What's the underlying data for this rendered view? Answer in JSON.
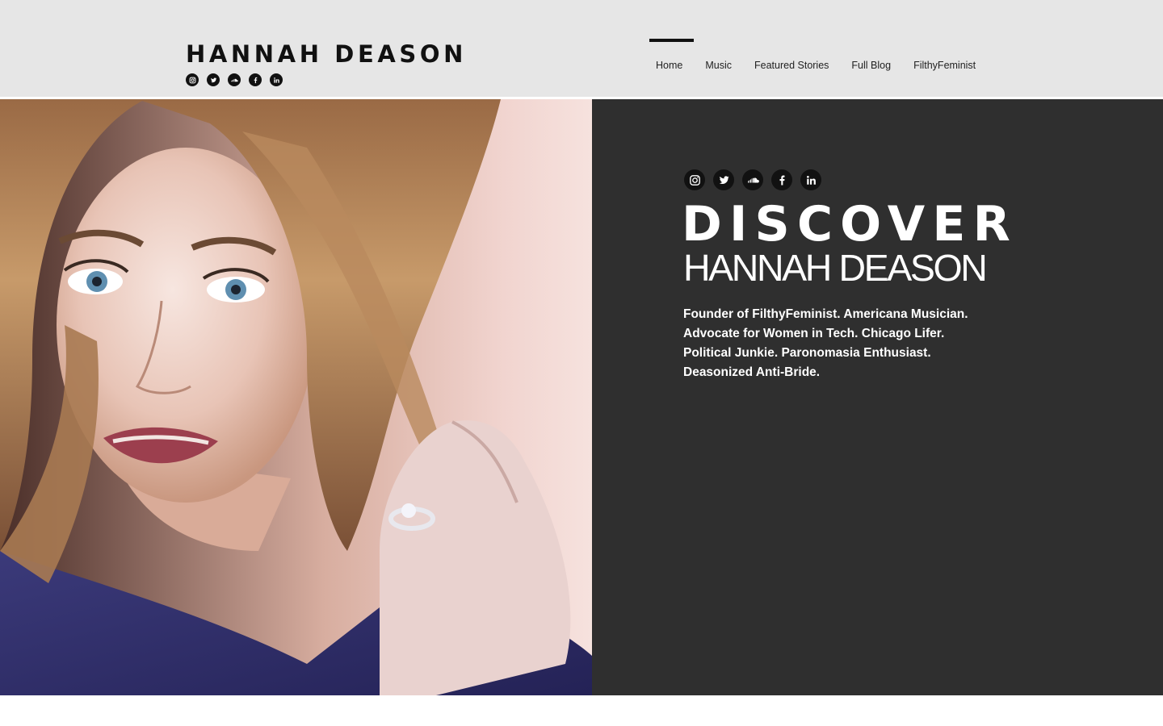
{
  "header": {
    "site_title": "HANNAH DEASON",
    "social_icons": [
      "instagram-icon",
      "twitter-icon",
      "soundcloud-icon",
      "facebook-icon",
      "linkedin-icon"
    ],
    "nav": [
      {
        "label": "Home",
        "active": true
      },
      {
        "label": "Music",
        "active": false
      },
      {
        "label": "Featured Stories",
        "active": false
      },
      {
        "label": "Full Blog",
        "active": false
      },
      {
        "label": "FilthyFeminist",
        "active": false
      }
    ]
  },
  "hero": {
    "photo_alt": "Portrait of Hannah Deason",
    "social_icons": [
      "instagram-icon",
      "twitter-icon",
      "soundcloud-icon",
      "facebook-icon",
      "linkedin-icon"
    ],
    "headline": "DISCOVER",
    "subheadline": "HANNAH DEASON",
    "bio": "Founder of FilthyFeminist. Americana Musician. Advocate for Women in Tech. Chicago Lifer. Political Junkie. Paronomasia Enthusiast. Deasonized Anti-Bride."
  },
  "colors": {
    "header_bg": "#e6e6e6",
    "panel_bg": "#2f2f2f",
    "text_dark": "#111111",
    "text_light": "#ffffff"
  }
}
